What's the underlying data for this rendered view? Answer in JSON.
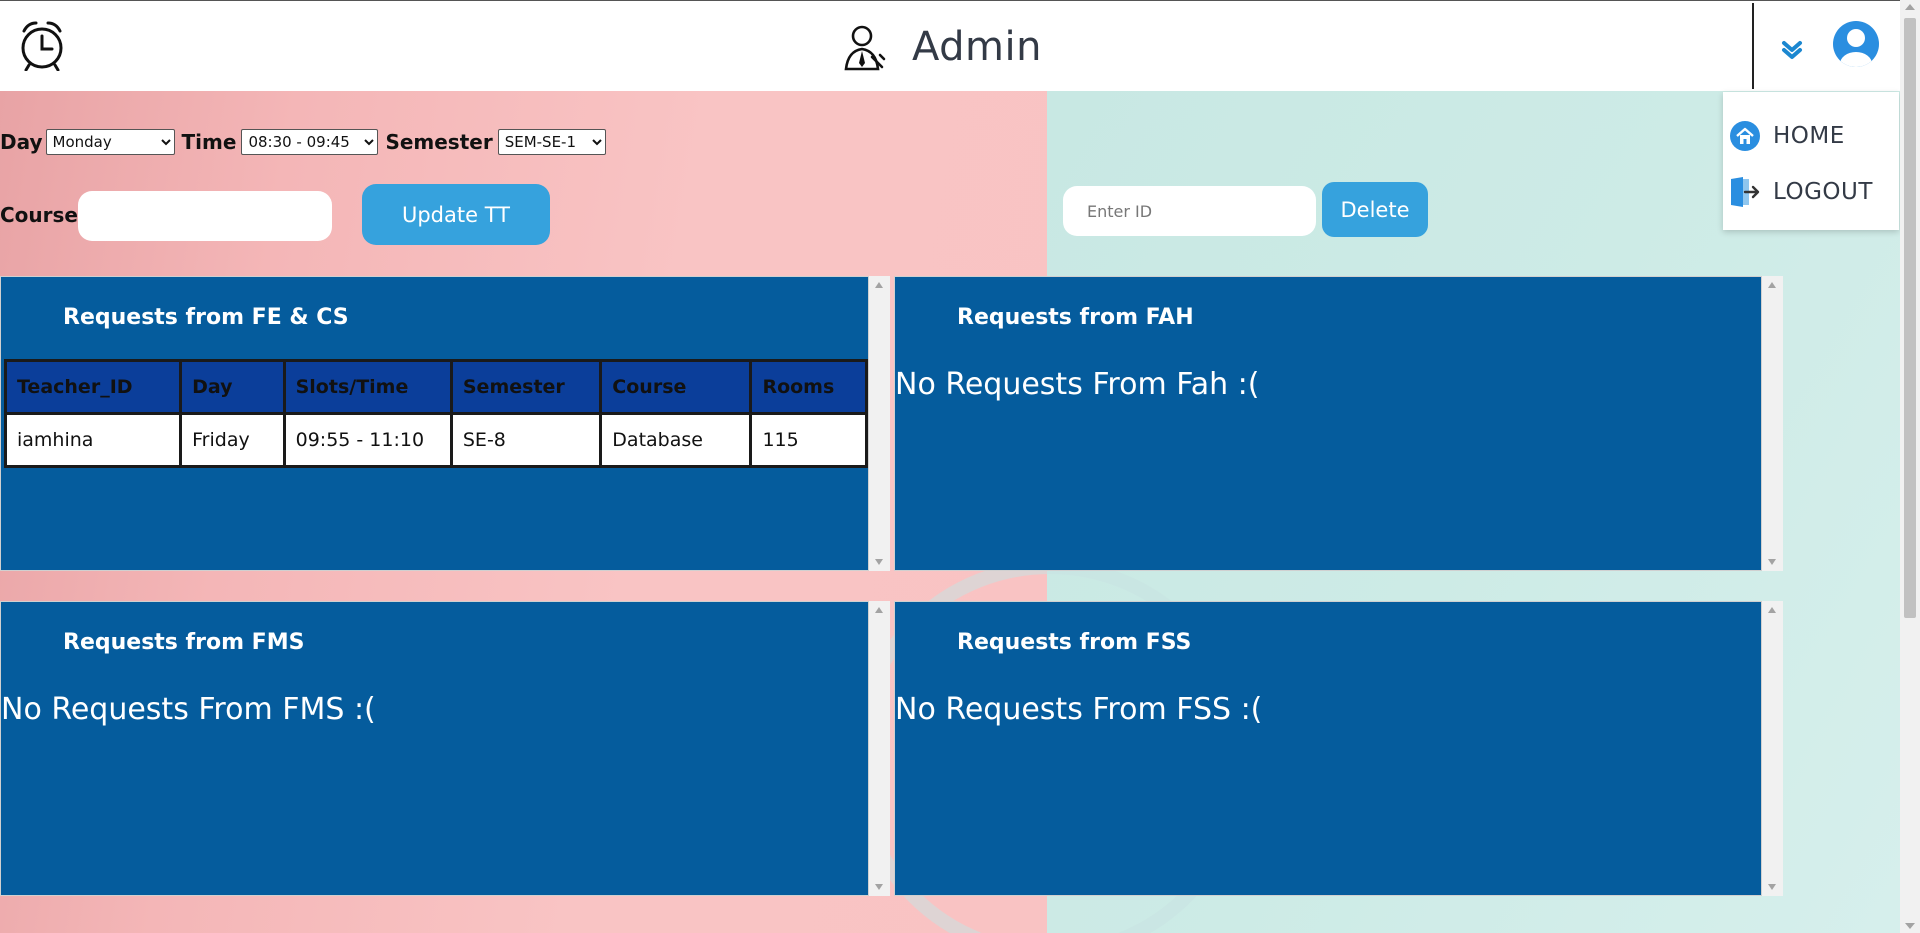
{
  "header": {
    "title": "Admin"
  },
  "menu": {
    "items": [
      {
        "label": "HOME",
        "icon": "home-icon"
      },
      {
        "label": "LOGOUT",
        "icon": "logout-icon"
      }
    ]
  },
  "form": {
    "day_label": "Day",
    "day_value": "Monday",
    "time_label": "Time",
    "time_value": "08:30 - 09:45",
    "semester_label": "Semester",
    "semester_value": "SEM-SE-1",
    "course_label": "Course",
    "course_value": "",
    "update_button": "Update TT",
    "id_placeholder": "Enter ID",
    "delete_button": "Delete"
  },
  "panels": {
    "fecs": {
      "title": "Requests from FE & CS",
      "columns": [
        "Teacher_ID",
        "Day",
        "Slots/Time",
        "Semester",
        "Course",
        "Rooms"
      ],
      "rows": [
        [
          "iamhina",
          "Friday",
          "09:55 - 11:10",
          "SE-8",
          "Database",
          "115"
        ]
      ]
    },
    "fah": {
      "title": "Requests from FAH",
      "empty": "No Requests From Fah :("
    },
    "fms": {
      "title": "Requests from FMS",
      "empty": "No Requests From FMS :("
    },
    "fss": {
      "title": "Requests from FSS",
      "empty": "No Requests From FSS :("
    }
  },
  "colors": {
    "panel": "#055c9d",
    "button": "#36a2dd",
    "bg_left": "#f9c3c3",
    "bg_right": "#cdebe6"
  }
}
